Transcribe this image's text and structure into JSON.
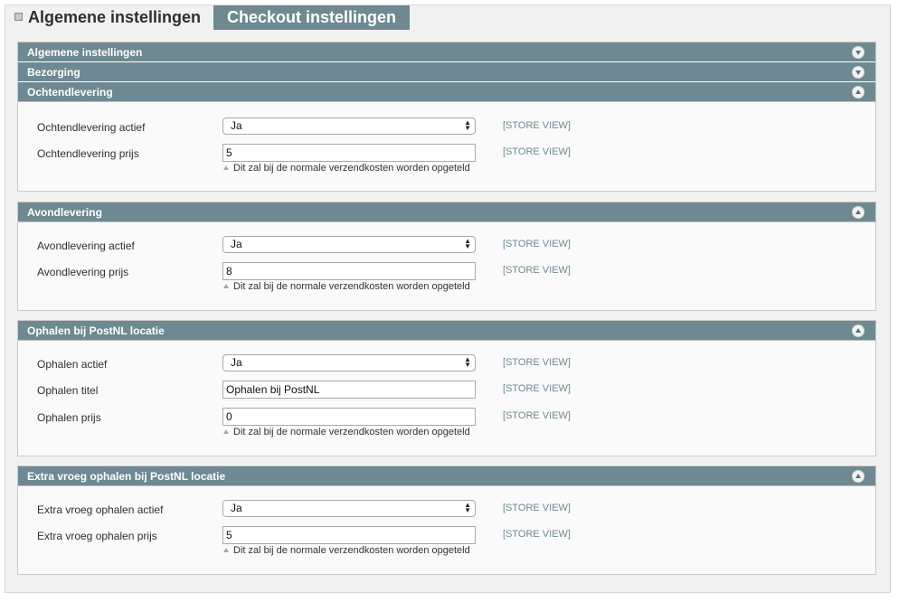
{
  "tabs": {
    "inactive_label": "Algemene instellingen",
    "active_label": "Checkout instellingen"
  },
  "scope_label": "[STORE VIEW]",
  "sections": {
    "algemeen": {
      "title": "Algemene instellingen",
      "state": "collapsed"
    },
    "bezorging": {
      "title": "Bezorging",
      "state": "collapsed"
    },
    "ochtend": {
      "title": "Ochtendlevering",
      "state": "expanded",
      "active_label": "Ochtendlevering actief",
      "active_value": "Ja",
      "price_label": "Ochtendlevering prijs",
      "price_value": "5",
      "note": "Dit zal bij de normale verzendkosten worden opgeteld"
    },
    "avond": {
      "title": "Avondlevering",
      "state": "expanded",
      "active_label": "Avondlevering actief",
      "active_value": "Ja",
      "price_label": "Avondlevering prijs",
      "price_value": "8",
      "note": "Dit zal bij de normale verzendkosten worden opgeteld"
    },
    "ophalen": {
      "title": "Ophalen bij PostNL locatie",
      "state": "expanded",
      "active_label": "Ophalen actief",
      "active_value": "Ja",
      "title_label": "Ophalen titel",
      "title_value": "Ophalen bij PostNL",
      "price_label": "Ophalen prijs",
      "price_value": "0",
      "note": "Dit zal bij de normale verzendkosten worden opgeteld"
    },
    "extra": {
      "title": "Extra vroeg ophalen bij PostNL locatie",
      "state": "expanded",
      "active_label": "Extra vroeg ophalen actief",
      "active_value": "Ja",
      "price_label": "Extra vroeg ophalen prijs",
      "price_value": "5",
      "note": "Dit zal bij de normale verzendkosten worden opgeteld"
    }
  },
  "colors": {
    "header_bg": "#6f8992",
    "panel_bg": "#fafafa",
    "scope_text": "#6f8992"
  },
  "icons": {
    "collapsed_toggle": "chevron-down-icon",
    "expanded_toggle": "chevron-up-icon",
    "tab_icon": "tab-icon"
  }
}
